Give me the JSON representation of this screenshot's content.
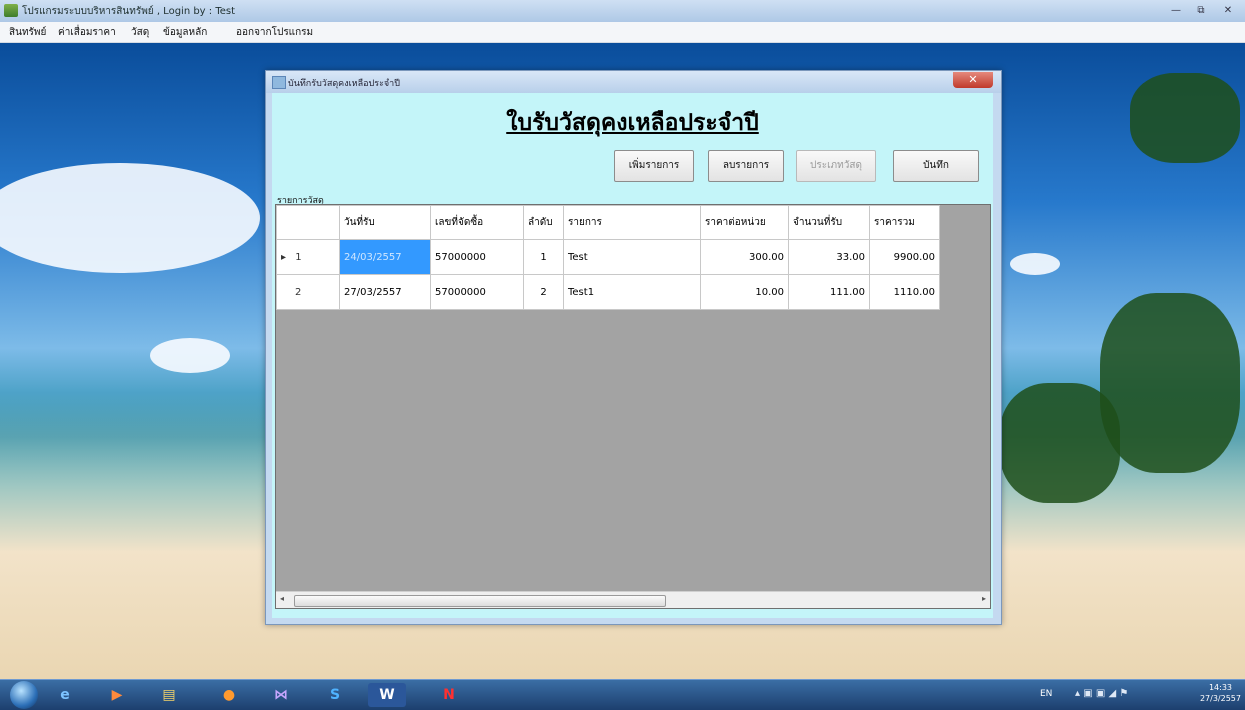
{
  "app": {
    "title": "โปรแกรมระบบบริหารสินทรัพย์ , Login by : Test",
    "minimize_label": "—",
    "restore_label": "⧉",
    "close_label": "✕"
  },
  "menu": {
    "items": [
      "สินทรัพย์",
      "ค่าเสื่อมราคา",
      "วัสดุ",
      "ข้อมูลหลัก",
      "ออกจากโปรแกรม"
    ]
  },
  "form": {
    "title": "บันทึกรับวัสดุคงเหลือประจำปี",
    "close_label": "✕",
    "heading": "ใบรับวัสดุคงเหลือประจำปี",
    "buttons": {
      "add": "เพิ่มรายการ",
      "delete": "ลบรายการ",
      "material_type": "ประเภทวัสดุ",
      "save": "บันทึก"
    },
    "group_label": "รายการวัสดุ"
  },
  "grid": {
    "columns": [
      "วันที่รับ",
      "เลขที่จัดซื้อ",
      "ลำดับ",
      "รายการ",
      "ราคาต่อหน่วย",
      "จำนวนที่รับ",
      "ราคารวม"
    ],
    "rows": [
      {
        "marker": "▸",
        "rownum": "1",
        "date": "24/03/2557",
        "po": "57000000",
        "seq": "1",
        "item": "Test",
        "unit_price": "300.00",
        "qty": "33.00",
        "total": "9900.00"
      },
      {
        "marker": "",
        "rownum": "2",
        "date": "27/03/2557",
        "po": "57000000",
        "seq": "2",
        "item": "Test1",
        "unit_price": "10.00",
        "qty": "111.00",
        "total": "1110.00"
      }
    ]
  },
  "taskbar": {
    "lang": "EN",
    "time": "14:33",
    "date": "27/3/2557"
  },
  "colors": {
    "selection": "#3399ff",
    "form_body": "#c4f5f9",
    "grid_empty": "#a3a3a3"
  }
}
